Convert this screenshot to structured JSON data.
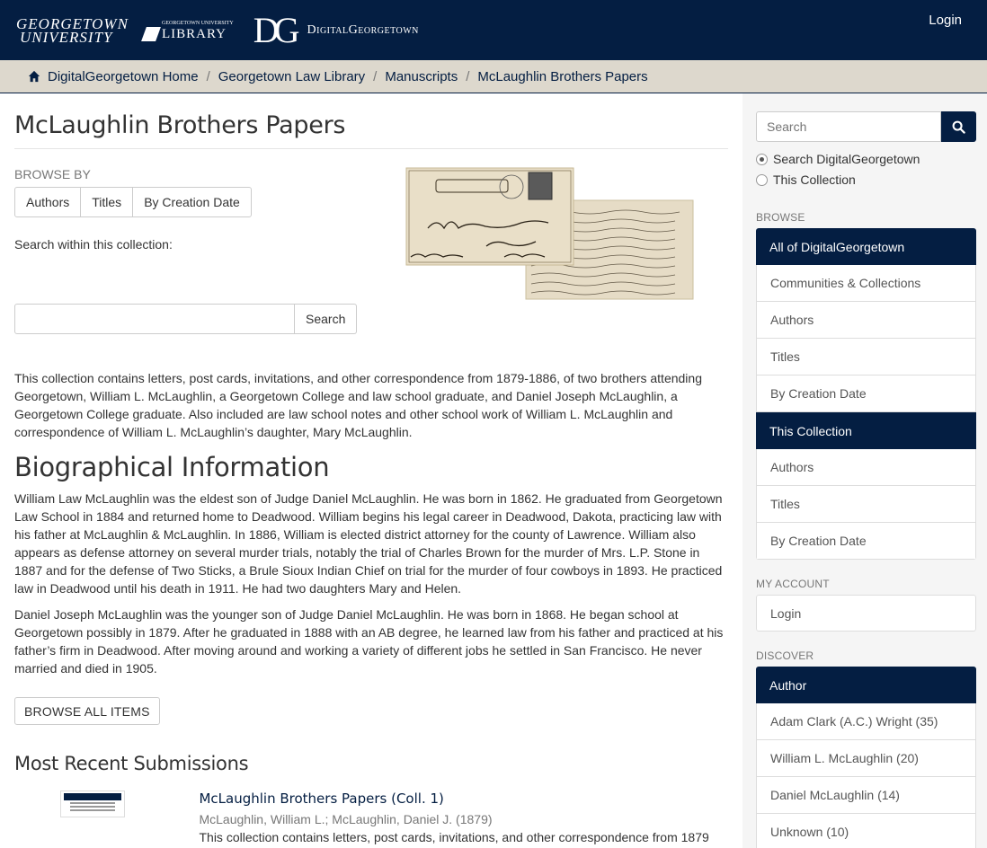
{
  "header": {
    "gu_logo_line1": "GEORGETOWN",
    "gu_logo_line2": "UNIVERSITY",
    "library_small": "GEORGETOWN UNIVERSITY",
    "library_big": "LIBRARY",
    "dg_mark": "DG",
    "dg_name": "DigitalGeorgetown",
    "login": "Login"
  },
  "breadcrumb": {
    "items": [
      "DigitalGeorgetown Home",
      "Georgetown Law Library",
      "Manuscripts",
      "McLaughlin Brothers Papers"
    ],
    "separator": "/"
  },
  "main": {
    "title": "McLaughlin Brothers Papers",
    "browse_by": "BROWSE BY",
    "browse_buttons": [
      "Authors",
      "Titles",
      "By Creation Date"
    ],
    "search_within_label": "Search within this collection:",
    "search_value": "",
    "search_button": "Search",
    "intro": "This collection contains letters, post cards, invitations, and other correspondence from 1879-1886, of two brothers attending Georgetown, William L. McLaughlin, a Georgetown College and law school graduate, and Daniel Joseph McLaughlin, a Georgetown College graduate. Also included are law school notes and other school work of William L. McLaughlin and correspondence of William L. McLaughlin’s daughter, Mary McLaughlin.",
    "bio_title": "Biographical Information",
    "bio_p1": "William Law McLaughlin was the eldest son of Judge Daniel McLaughlin. He was born in 1862. He graduated from Georgetown Law School in 1884 and returned home to Deadwood. William begins his legal career in Deadwood, Dakota, practicing law with his father at McLaughlin & McLaughlin. In 1886, William is elected district attorney for the county of Lawrence. William also appears as defense attorney on several murder trials, notably the trial of Charles Brown for the murder of Mrs. L.P. Stone in 1887 and for the defense of Two Sticks, a Brule Sioux Indian Chief on trial for the murder of four cowboys in 1893. He practiced law in Deadwood until his death in 1911. He had two daughters Mary and Helen.",
    "bio_p2": "Daniel Joseph McLaughlin was the younger son of Judge Daniel McLaughlin. He was born in 1868. He began school at Georgetown possibly in 1879. After he graduated in 1888 with an AB degree, he learned law from his father and practiced at his father’s firm in Deadwood. After moving around and working a variety of different jobs he settled in San Francisco. He never married and died in 1905.",
    "browse_all": "BROWSE ALL ITEMS",
    "recent_title": "Most Recent Submissions",
    "recent_item": {
      "title": "McLaughlin Brothers Papers (Coll. 1)",
      "meta": "McLaughlin, William L.; McLaughlin, Daniel J. (1879)",
      "abstract": "This collection contains letters, post cards, invitations, and other correspondence from 1879"
    }
  },
  "sidebar": {
    "search_placeholder": "Search",
    "radio_options": [
      "Search DigitalGeorgetown",
      "This Collection"
    ],
    "browse_head": "BROWSE",
    "all_head": "All of DigitalGeorgetown",
    "all_items": [
      "Communities & Collections",
      "Authors",
      "Titles",
      "By Creation Date"
    ],
    "coll_head": "This Collection",
    "coll_items": [
      "Authors",
      "Titles",
      "By Creation Date"
    ],
    "account_head": "MY ACCOUNT",
    "account_login": "Login",
    "discover_head": "DISCOVER",
    "author_head": "Author",
    "author_items": [
      "Adam Clark (A.C.) Wright (35)",
      "William L. McLaughlin (20)",
      "Daniel McLaughlin (14)",
      "Unknown (10)"
    ]
  },
  "colors": {
    "navy": "#041e42",
    "breadcrumb_bg": "#ddd8cd",
    "sidebar_bg": "#f5f5f5"
  }
}
